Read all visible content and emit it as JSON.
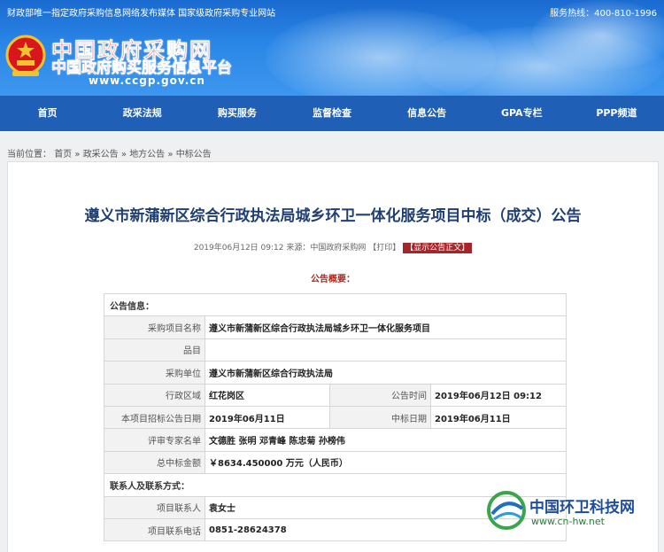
{
  "header": {
    "tagline": "财政部唯一指定政府采购信息网络发布媒体 国家级政府采购专业网站",
    "hotline": "服务热线：400-810-1996",
    "logo_cn": "中国政府采购网",
    "logo_sub": "中国政府购买服务信息平台",
    "logo_url": "www.ccgp.gov.cn"
  },
  "nav": [
    "首页",
    "政采法规",
    "购买服务",
    "监督检查",
    "信息公告",
    "GPA专栏",
    "PPP频道"
  ],
  "breadcrumb": {
    "prefix": "当前位置：",
    "items": [
      "首页",
      "政采公告",
      "地方公告",
      "中标公告"
    ],
    "sep": "»"
  },
  "article": {
    "title": "遵义市新蒲新区综合行政执法局城乡环卫一体化服务项目中标（成交）公告",
    "date": "2019年06月12日 09:12",
    "source": "来源：中国政府采购网",
    "print": "【打印】",
    "show_text": "【显示公告正文】",
    "summary_label": "公告概要："
  },
  "table": {
    "section1": "公告信息：",
    "rows": [
      {
        "label": "采购项目名称",
        "value": "遵义市新蒲新区综合行政执法局城乡环卫一体化服务项目"
      },
      {
        "label": "品目",
        "value": ""
      },
      {
        "label": "采购单位",
        "value": "遵义市新蒲新区综合行政执法局"
      }
    ],
    "row_region": {
      "label": "行政区域",
      "value": "红花岗区",
      "label2": "公告时间",
      "value2": "2019年06月12日 09:12"
    },
    "row_dates": {
      "label": "本项目招标公告日期",
      "value": "2019年06月11日",
      "label2": "中标日期",
      "value2": "2019年06月11日"
    },
    "row_experts": {
      "label": "评审专家名单",
      "value": "文德胜 张明 邓青峰 陈忠菊 孙榜伟"
    },
    "row_amount": {
      "label": "总中标金额",
      "value": "￥8634.450000 万元（人民币）"
    },
    "section2": "联系人及联系方式：",
    "contact": {
      "label": "项目联系人",
      "value": "袁女士"
    },
    "phone": {
      "label": "项目联系电话",
      "value": "0851-28624378"
    }
  },
  "watermark": {
    "name": "中国环卫科技网",
    "url": "www.cn-hw.net"
  },
  "colors": {
    "nav": "#1f5fb5",
    "title": "#1f3f73",
    "logo_red": "#d8161b",
    "accent_red": "#a6252b"
  }
}
